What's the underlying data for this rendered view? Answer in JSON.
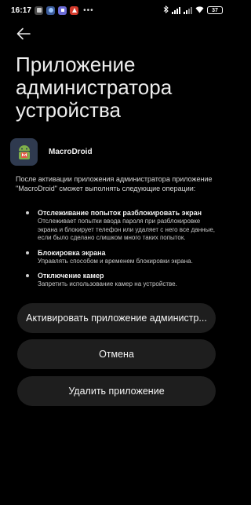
{
  "status_bar": {
    "time": "16:17",
    "notification_icons": [
      "app-notif-icon",
      "android-notif-icon",
      "app-notif-icon",
      "alert-notif-icon"
    ],
    "more_dots": "•••",
    "network": "4G",
    "battery": "37",
    "colors": {
      "notif1": "#4a4a4a",
      "notif2": "#3b5b9a",
      "notif3": "#6b6bd6",
      "notif4": "#d33a2c"
    }
  },
  "page": {
    "title": "Приложение администратора устройства"
  },
  "app": {
    "name": "MacroDroid",
    "icon": "macrodroid-app-icon"
  },
  "description": "После активации приложения администратора приложение \"MacroDroid\" сможет выполнять следующие операции:",
  "policies": [
    {
      "title": "Отслеживание попыток разблокировать экран",
      "desc": "Отслеживает попытки ввода пароля при разблокировке экрана и блокирует телефон или удаляет с него все данные, если было сделано слишком много таких попыток."
    },
    {
      "title": "Блокировка экрана",
      "desc": "Управлять способом и временем блокировки экрана."
    },
    {
      "title": "Отключение камер",
      "desc": "Запретить использование камер на устройстве."
    }
  ],
  "buttons": {
    "activate": "Активировать приложение администр...",
    "cancel": "Отмена",
    "uninstall": "Удалить приложение"
  }
}
